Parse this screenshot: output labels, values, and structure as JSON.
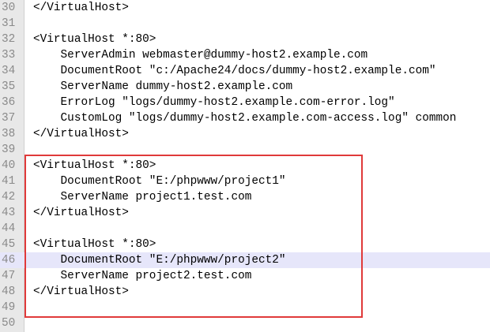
{
  "editor": {
    "lines": [
      {
        "number": "30",
        "text": "</VirtualHost>"
      },
      {
        "number": "31",
        "text": ""
      },
      {
        "number": "32",
        "text": "<VirtualHost *:80>"
      },
      {
        "number": "33",
        "text": "    ServerAdmin webmaster@dummy-host2.example.com"
      },
      {
        "number": "34",
        "text": "    DocumentRoot \"c:/Apache24/docs/dummy-host2.example.com\""
      },
      {
        "number": "35",
        "text": "    ServerName dummy-host2.example.com"
      },
      {
        "number": "36",
        "text": "    ErrorLog \"logs/dummy-host2.example.com-error.log\""
      },
      {
        "number": "37",
        "text": "    CustomLog \"logs/dummy-host2.example.com-access.log\" common"
      },
      {
        "number": "38",
        "text": "</VirtualHost>"
      },
      {
        "number": "39",
        "text": ""
      },
      {
        "number": "40",
        "text": "<VirtualHost *:80>"
      },
      {
        "number": "41",
        "text": "    DocumentRoot \"E:/phpwww/project1\""
      },
      {
        "number": "42",
        "text": "    ServerName project1.test.com"
      },
      {
        "number": "43",
        "text": "</VirtualHost>"
      },
      {
        "number": "44",
        "text": ""
      },
      {
        "number": "45",
        "text": "<VirtualHost *:80>"
      },
      {
        "number": "46",
        "text": "    DocumentRoot \"E:/phpwww/project2\""
      },
      {
        "number": "47",
        "text": "    ServerName project2.test.com"
      },
      {
        "number": "48",
        "text": "</VirtualHost>"
      },
      {
        "number": "49",
        "text": ""
      },
      {
        "number": "50",
        "text": ""
      }
    ],
    "current_line": "46",
    "highlight_color": "#e03a3a"
  }
}
